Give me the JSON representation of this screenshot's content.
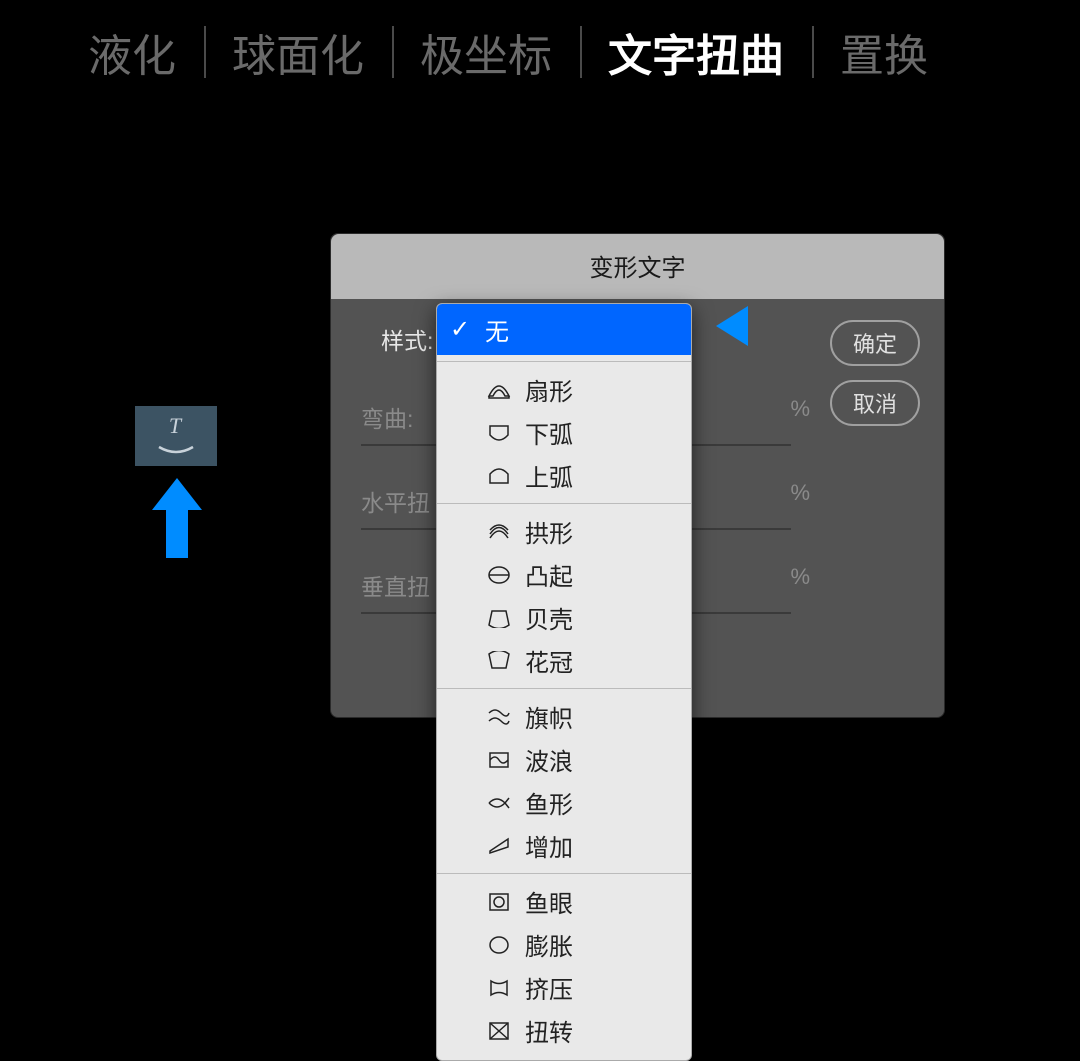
{
  "tabs": {
    "items": [
      {
        "label": "液化",
        "active": false
      },
      {
        "label": "球面化",
        "active": false
      },
      {
        "label": "极坐标",
        "active": false
      },
      {
        "label": "文字扭曲",
        "active": true
      },
      {
        "label": "置换",
        "active": false
      }
    ]
  },
  "dialog": {
    "title": "变形文字",
    "style_label": "样式:",
    "fields": {
      "bend": {
        "label": "弯曲:",
        "unit": "%"
      },
      "horizontal_distort": {
        "label": "水平扭",
        "unit": "%"
      },
      "vertical_distort": {
        "label": "垂直扭",
        "unit": "%"
      }
    },
    "buttons": {
      "ok": "确定",
      "cancel": "取消"
    }
  },
  "dropdown": {
    "selected_index": 0,
    "groups": [
      [
        {
          "label": "无",
          "icon": "none"
        }
      ],
      [
        {
          "label": "扇形",
          "icon": "arc"
        },
        {
          "label": "下弧",
          "icon": "arc-lower"
        },
        {
          "label": "上弧",
          "icon": "arc-upper"
        }
      ],
      [
        {
          "label": "拱形",
          "icon": "arch"
        },
        {
          "label": "凸起",
          "icon": "bulge"
        },
        {
          "label": "贝壳",
          "icon": "shell-lower"
        },
        {
          "label": "花冠",
          "icon": "shell-upper"
        }
      ],
      [
        {
          "label": "旗帜",
          "icon": "flag"
        },
        {
          "label": "波浪",
          "icon": "wave"
        },
        {
          "label": "鱼形",
          "icon": "fish"
        },
        {
          "label": "增加",
          "icon": "rise"
        }
      ],
      [
        {
          "label": "鱼眼",
          "icon": "fisheye"
        },
        {
          "label": "膨胀",
          "icon": "inflate"
        },
        {
          "label": "挤压",
          "icon": "squeeze"
        },
        {
          "label": "扭转",
          "icon": "twist"
        }
      ]
    ]
  }
}
